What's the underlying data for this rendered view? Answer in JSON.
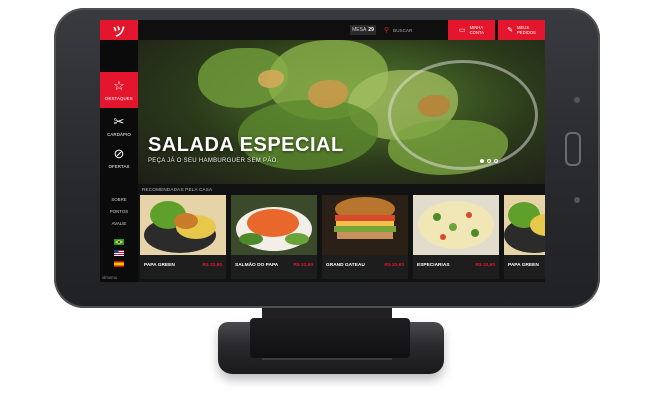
{
  "sidebar": {
    "logo": "ツ",
    "items": [
      {
        "icon": "star-icon",
        "glyph": "☆",
        "label": "DESTAQUES",
        "active": true
      },
      {
        "icon": "cutlery-icon",
        "glyph": "✂",
        "label": "CARDÁPIO",
        "active": false
      },
      {
        "icon": "percent-icon",
        "glyph": "⊘",
        "label": "OFERTAS",
        "active": false
      }
    ],
    "links": [
      "SOBRE",
      "PONTOS",
      "AVALIE"
    ],
    "brand": "olrnemu"
  },
  "topbar": {
    "mesa_label": "MESA",
    "mesa_number": "29",
    "search_placeholder": "BUSCAR",
    "account_label_1": "MINHA",
    "account_label_2": "CONTA",
    "orders_label_1": "MEUS",
    "orders_label_2": "PEDIDOS"
  },
  "hero": {
    "title": "SALADA ESPECIAL",
    "subtitle": "PEÇA JÁ O SEU HAMBURGUER SEM PÃO.",
    "slide_count": 3,
    "active_slide": 0
  },
  "recommended": {
    "label": "RECOMENDADAS PELA CASA",
    "items": [
      {
        "name": "PAPA GREEN",
        "price": "R$ 22,90"
      },
      {
        "name": "SALMÃO DO PAPA",
        "price": "R$ 22,90"
      },
      {
        "name": "GRAND GATEAU",
        "price": "R$ 22,93"
      },
      {
        "name": "ESPECIARIAS",
        "price": "R$ 22,90"
      },
      {
        "name": "PAPA GREEN",
        "price": ""
      }
    ]
  },
  "colors": {
    "accent": "#e4162e",
    "background": "#121212"
  }
}
